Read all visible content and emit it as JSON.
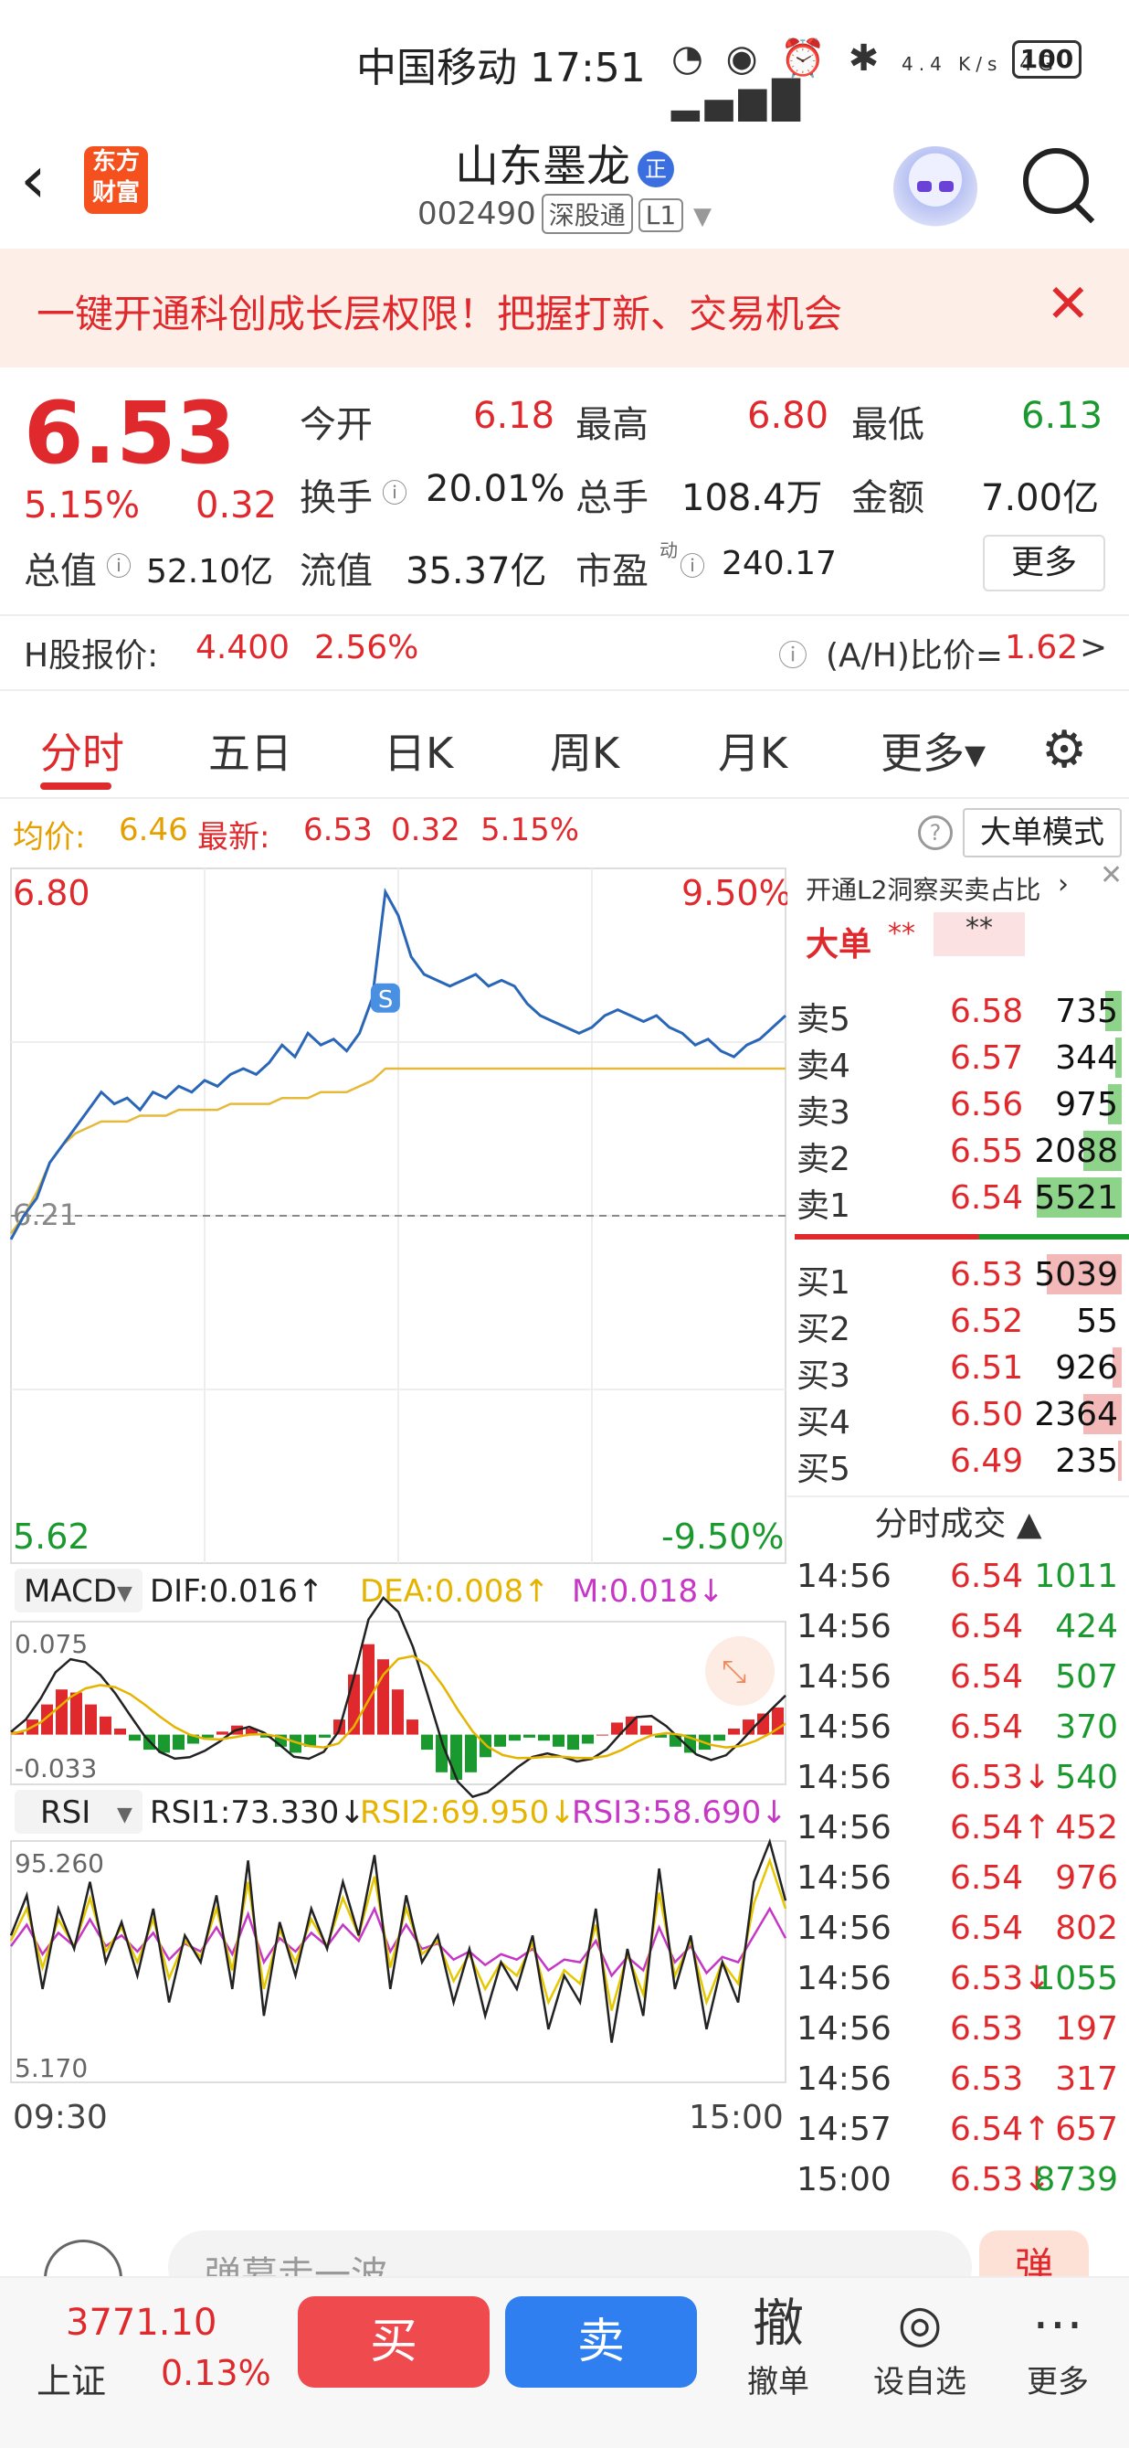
{
  "status_bar": {
    "carrier_time": "中国移动 17:51",
    "net_speed": "4.4 K/s",
    "signal": "4G",
    "battery": "100"
  },
  "header": {
    "logo": "东方财富",
    "title": "山东墨龙",
    "badge": "正",
    "code": "002490",
    "exchange_tag": "深股通",
    "level_tag": "L1"
  },
  "banner": {
    "text": "一键开通科创成长层权限！把握打新、交易机会"
  },
  "quote": {
    "price": "6.53",
    "change_pct": "5.15%",
    "change": "0.32",
    "open_label": "今开",
    "open": "6.18",
    "high_label": "最高",
    "high": "6.80",
    "low_label": "最低",
    "low": "6.13",
    "turnover_label": "换手",
    "turnover": "20.01%",
    "volume_label": "总手",
    "volume": "108.4万",
    "amount_label": "金额",
    "amount": "7.00亿",
    "mktcap_label": "总值",
    "mktcap": "52.10亿",
    "float_label": "流值",
    "float": "35.37亿",
    "pe_label": "市盈",
    "pe_sup": "动",
    "pe": "240.17",
    "more": "更多"
  },
  "hshare": {
    "label": "H股报价:",
    "price": "4.400",
    "pct": "2.56%",
    "ah_label": "(A/H)比价=",
    "ah_value": "1.62",
    "arrow": ">"
  },
  "tabs": [
    "分时",
    "五日",
    "日K",
    "周K",
    "月K",
    "更多▾"
  ],
  "avg_line": {
    "avg_label": "均价:",
    "avg": "6.46",
    "latest_label": "最新:",
    "latest": "6.53",
    "chg": "0.32",
    "pct": "5.15%",
    "mode": "大单模式"
  },
  "chart_data": [
    {
      "type": "line",
      "title": "",
      "top_left": "6.80",
      "top_right": "9.50%",
      "bottom_left": "5.62",
      "bottom_right": "-9.50%",
      "ref_label": "6.21",
      "x_labels": [
        "09:30",
        "15:00"
      ],
      "ylim": [
        5.62,
        6.8
      ],
      "reference": 6.21,
      "series": [
        {
          "name": "最新",
          "color": "#2a66b8",
          "values": [
            6.17,
            6.21,
            6.24,
            6.3,
            6.33,
            6.36,
            6.39,
            6.42,
            6.4,
            6.41,
            6.39,
            6.42,
            6.41,
            6.43,
            6.42,
            6.44,
            6.43,
            6.45,
            6.46,
            6.45,
            6.47,
            6.5,
            6.48,
            6.52,
            6.5,
            6.51,
            6.49,
            6.52,
            6.58,
            6.76,
            6.72,
            6.65,
            6.62,
            6.61,
            6.6,
            6.61,
            6.62,
            6.6,
            6.61,
            6.6,
            6.57,
            6.55,
            6.54,
            6.53,
            6.52,
            6.53,
            6.55,
            6.56,
            6.55,
            6.54,
            6.55,
            6.53,
            6.52,
            6.5,
            6.51,
            6.49,
            6.48,
            6.5,
            6.51,
            6.53,
            6.55
          ]
        },
        {
          "name": "均价",
          "color": "#e7b93a",
          "values": [
            6.18,
            6.21,
            6.25,
            6.3,
            6.33,
            6.35,
            6.36,
            6.37,
            6.37,
            6.37,
            6.38,
            6.38,
            6.38,
            6.39,
            6.39,
            6.39,
            6.39,
            6.4,
            6.4,
            6.4,
            6.4,
            6.41,
            6.41,
            6.41,
            6.42,
            6.42,
            6.42,
            6.43,
            6.44,
            6.46,
            6.46,
            6.46,
            6.46,
            6.46,
            6.46,
            6.46,
            6.46,
            6.46,
            6.46,
            6.46,
            6.46,
            6.46,
            6.46,
            6.46,
            6.46,
            6.46,
            6.46,
            6.46,
            6.46,
            6.46,
            6.46,
            6.46,
            6.46,
            6.46,
            6.46,
            6.46,
            6.46,
            6.46,
            6.46,
            6.46,
            6.46
          ]
        }
      ]
    },
    {
      "type": "bar",
      "title": "MACD",
      "dif_label": "DIF:0.016↑",
      "dea_label": "DEA:0.008↑",
      "m_label": "M:0.018↓",
      "ylim": [
        -0.033,
        0.075
      ],
      "top_label": "0.075",
      "bottom_label": "-0.033",
      "values": [
        0.002,
        0.01,
        0.02,
        0.03,
        0.028,
        0.02,
        0.012,
        0.004,
        -0.004,
        -0.01,
        -0.012,
        -0.01,
        -0.006,
        -0.002,
        0.002,
        0.006,
        0.004,
        -0.002,
        -0.008,
        -0.012,
        -0.008,
        -0.002,
        0.01,
        0.04,
        0.06,
        0.05,
        0.03,
        0.01,
        -0.01,
        -0.025,
        -0.03,
        -0.025,
        -0.015,
        -0.008,
        -0.004,
        -0.002,
        -0.004,
        -0.008,
        -0.01,
        -0.006,
        0.0,
        0.008,
        0.012,
        0.006,
        -0.002,
        -0.008,
        -0.012,
        -0.01,
        -0.004,
        0.004,
        0.01,
        0.014,
        0.018
      ]
    },
    {
      "type": "line",
      "title": "RSI",
      "rsi1_label": "RSI1:73.330↓",
      "rsi2_label": "RSI2:69.950↓",
      "rsi3_label": "RSI3:58.690↓",
      "ylim": [
        5.17,
        95.26
      ],
      "top_label": "95.260",
      "bottom_label": "5.170",
      "series": [
        {
          "name": "RSI1",
          "color": "#222222",
          "values": [
            60,
            75,
            40,
            70,
            55,
            80,
            50,
            65,
            45,
            70,
            35,
            60,
            50,
            75,
            40,
            88,
            30,
            65,
            45,
            70,
            55,
            80,
            60,
            90,
            40,
            75,
            50,
            60,
            35,
            55,
            30,
            50,
            40,
            60,
            25,
            45,
            35,
            70,
            20,
            55,
            30,
            85,
            40,
            60,
            25,
            50,
            35,
            80,
            95,
            73
          ]
        },
        {
          "name": "RSI2",
          "color": "#e5c800",
          "values": [
            58,
            70,
            48,
            66,
            56,
            74,
            54,
            63,
            50,
            66,
            44,
            58,
            52,
            70,
            47,
            80,
            40,
            62,
            50,
            66,
            56,
            74,
            60,
            82,
            48,
            70,
            53,
            58,
            43,
            53,
            40,
            50,
            45,
            57,
            35,
            47,
            42,
            64,
            32,
            53,
            38,
            76,
            45,
            58,
            35,
            50,
            42,
            72,
            88,
            70
          ]
        },
        {
          "name": "RSI3",
          "color": "#c637c6",
          "values": [
            56,
            64,
            53,
            61,
            56,
            66,
            56,
            60,
            54,
            61,
            51,
            57,
            54,
            63,
            53,
            68,
            50,
            59,
            54,
            61,
            56,
            64,
            58,
            70,
            54,
            64,
            55,
            57,
            51,
            54,
            49,
            53,
            51,
            55,
            47,
            51,
            50,
            58,
            45,
            52,
            47,
            63,
            50,
            56,
            46,
            52,
            50,
            60,
            70,
            59
          ]
        }
      ]
    }
  ],
  "orderbook": {
    "header": "开通L2洞察买卖占比",
    "big_order_label": "大单",
    "stars1": "**",
    "stars2": "**",
    "asks": [
      {
        "label": "卖5",
        "price": "6.58",
        "vol": "735",
        "fill": 0.12
      },
      {
        "label": "卖4",
        "price": "6.57",
        "vol": "344",
        "fill": 0.05
      },
      {
        "label": "卖3",
        "price": "6.56",
        "vol": "975",
        "fill": 0.1
      },
      {
        "label": "卖2",
        "price": "6.55",
        "vol": "2088",
        "fill": 0.28
      },
      {
        "label": "卖1",
        "price": "6.54",
        "vol": "5521",
        "fill": 0.62
      }
    ],
    "bids": [
      {
        "label": "买1",
        "price": "6.53",
        "vol": "5039",
        "fill": 0.55
      },
      {
        "label": "买2",
        "price": "6.52",
        "vol": "55",
        "fill": 0.0
      },
      {
        "label": "买3",
        "price": "6.51",
        "vol": "926",
        "fill": 0.07
      },
      {
        "label": "买4",
        "price": "6.50",
        "vol": "2364",
        "fill": 0.28
      },
      {
        "label": "买5",
        "price": "6.49",
        "vol": "235",
        "fill": 0.03
      }
    ],
    "ask_color": "#8ed38a",
    "bid_color": "#f3b8b8"
  },
  "trades": {
    "header": "分时成交 ▲",
    "rows": [
      {
        "t": "14:56",
        "p": "6.54",
        "v": "1011",
        "c": "green"
      },
      {
        "t": "14:56",
        "p": "6.54",
        "v": "424",
        "c": "green"
      },
      {
        "t": "14:56",
        "p": "6.54",
        "v": "507",
        "c": "green"
      },
      {
        "t": "14:56",
        "p": "6.54",
        "v": "370",
        "c": "green"
      },
      {
        "t": "14:56",
        "p": "6.53↓",
        "v": "540",
        "c": "green"
      },
      {
        "t": "14:56",
        "p": "6.54↑",
        "v": "452",
        "c": "red"
      },
      {
        "t": "14:56",
        "p": "6.54",
        "v": "976",
        "c": "red"
      },
      {
        "t": "14:56",
        "p": "6.54",
        "v": "802",
        "c": "red"
      },
      {
        "t": "14:56",
        "p": "6.53↓",
        "v": "1055",
        "c": "green"
      },
      {
        "t": "14:56",
        "p": "6.53",
        "v": "197",
        "c": "red"
      },
      {
        "t": "14:56",
        "p": "6.53",
        "v": "317",
        "c": "red"
      },
      {
        "t": "14:57",
        "p": "6.54↑",
        "v": "657",
        "c": "red"
      },
      {
        "t": "15:00",
        "p": "6.53↓",
        "v": "8739",
        "c": "green"
      }
    ]
  },
  "input": {
    "placeholder": "弹幕走一波"
  },
  "bottom": {
    "index_value": "3771.10",
    "index_name": "上证",
    "index_pct": "0.13%",
    "buy": "买",
    "sell": "卖",
    "cancel_icon": "撤",
    "cancel_label": "撤单",
    "watch_label": "设自选",
    "more_label": "更多"
  }
}
